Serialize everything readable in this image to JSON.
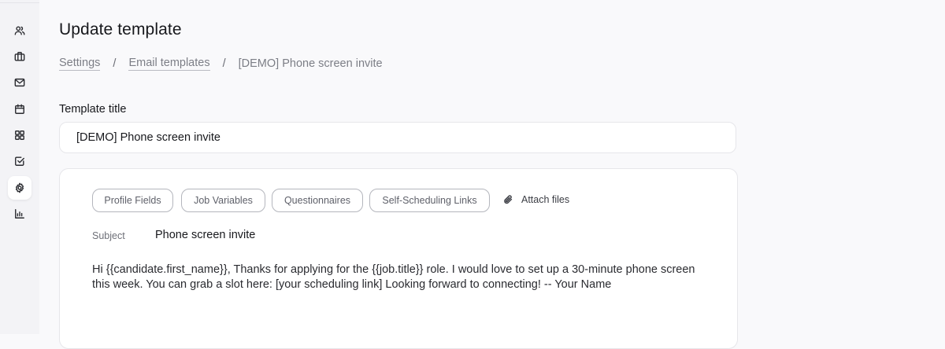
{
  "sidebar": {
    "items": [
      {
        "icon": "users-icon",
        "active": false
      },
      {
        "icon": "briefcase-icon",
        "active": false
      },
      {
        "icon": "mail-icon",
        "active": false
      },
      {
        "icon": "calendar-icon",
        "active": false
      },
      {
        "icon": "apps-icon",
        "active": false
      },
      {
        "icon": "checkbox-icon",
        "active": false
      },
      {
        "icon": "gear-icon",
        "active": true
      },
      {
        "icon": "bar-chart-icon",
        "active": false
      }
    ]
  },
  "header": {
    "title": "Update template",
    "breadcrumb": {
      "settings": "Settings",
      "separator": "/",
      "email_templates": "Email templates",
      "current": "[DEMO] Phone screen invite"
    }
  },
  "form": {
    "title_label": "Template title",
    "title_value": "[DEMO] Phone screen invite"
  },
  "editor": {
    "toolbar": {
      "profile_fields": "Profile Fields",
      "job_variables": "Job Variables",
      "questionnaires": "Questionnaires",
      "self_scheduling_links": "Self-Scheduling Links",
      "attach_files": "Attach files"
    },
    "subject_label": "Subject",
    "subject_value": "Phone screen invite",
    "body": "Hi {{candidate.first_name}}, Thanks for applying for the {{job.title}} role. I would love to set up a 30-minute phone screen this week. You can grab a slot here: [your scheduling link] Looking forward to connecting! -- Your Name"
  },
  "colors": {
    "page_bg": "#f9f9fb",
    "sidebar_bg": "#f3f3f6",
    "card_bg": "#ffffff",
    "border": "#e6e6ea",
    "chip_border": "#b4b6bd",
    "muted_text": "#7c7e86"
  }
}
